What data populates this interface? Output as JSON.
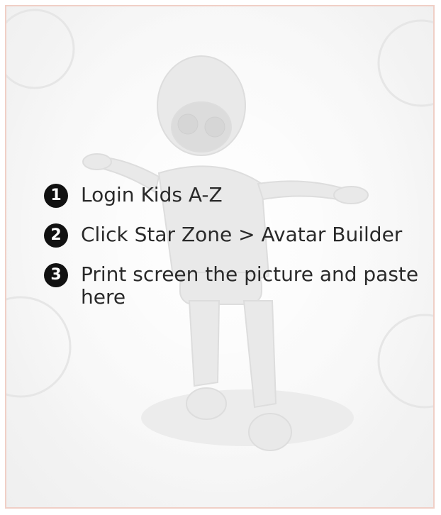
{
  "steps": [
    {
      "number": "1",
      "text": "Login Kids A-Z"
    },
    {
      "number": "2",
      "text": "Click Star Zone > Avatar Builder"
    },
    {
      "number": "3",
      "text": "Print screen the picture and paste here"
    }
  ],
  "colors": {
    "border": "#f0cfc6",
    "number_bg": "#111111",
    "text": "#2a2a2a",
    "background": "#f6f6f6"
  },
  "background_art": "faded-robot-illustration"
}
